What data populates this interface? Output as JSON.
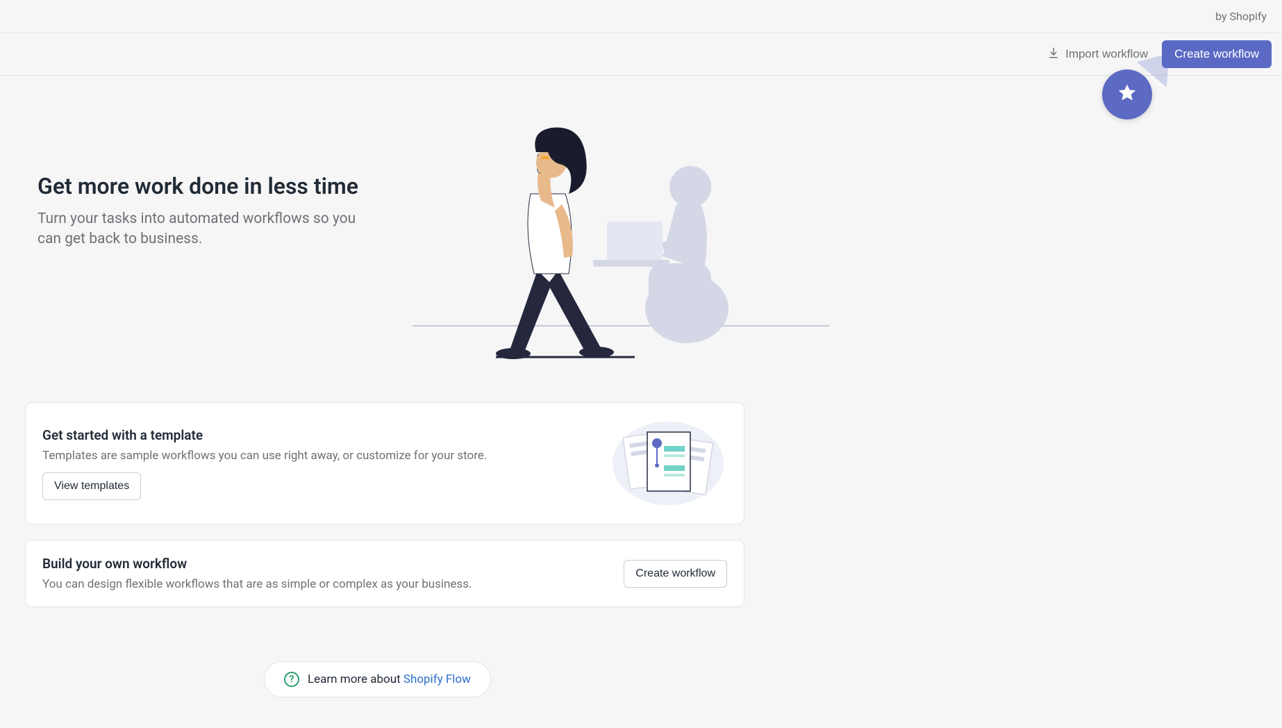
{
  "topbar": {
    "byline": "by Shopify"
  },
  "toolbar": {
    "import_label": "Import workflow",
    "create_label": "Create workflow"
  },
  "hero": {
    "title": "Get more work done in less time",
    "subtitle": "Turn your tasks into automated workflows so you can get back to business."
  },
  "cards": {
    "templates": {
      "title": "Get started with a template",
      "desc": "Templates are sample workflows you can use right away, or customize for your store.",
      "button": "View templates"
    },
    "build": {
      "title": "Build your own workflow",
      "desc": "You can design flexible workflows that are as simple or complex as your business.",
      "button": "Create workflow"
    }
  },
  "learn_more": {
    "prefix": "Learn more about ",
    "link_text": "Shopify Flow"
  }
}
